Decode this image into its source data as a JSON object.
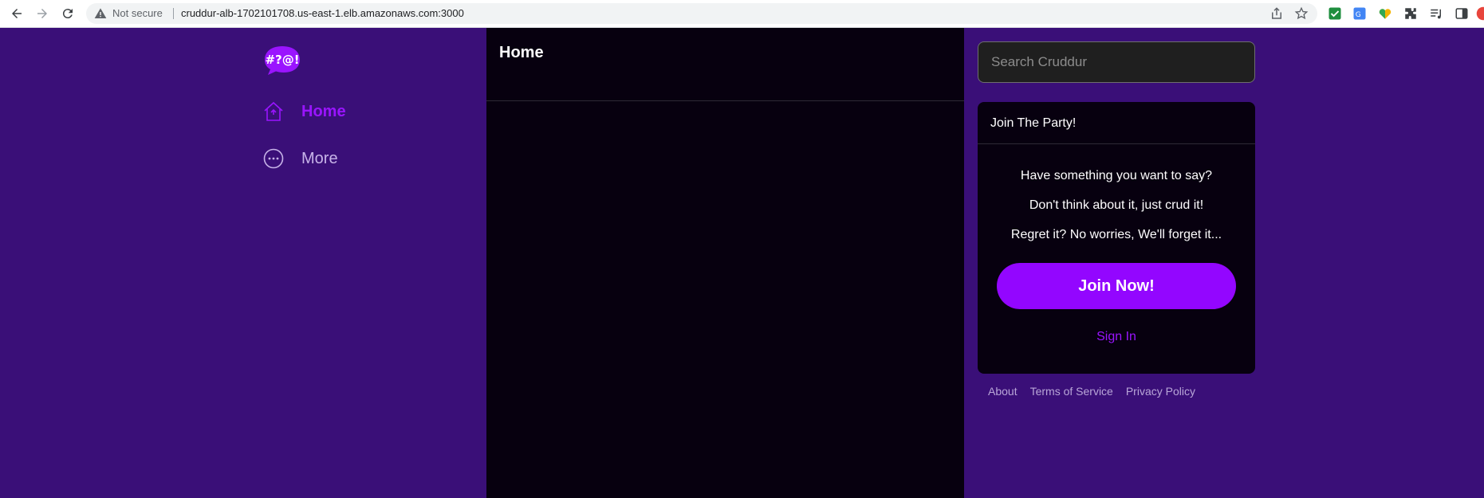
{
  "browser": {
    "security_label": "Not secure",
    "url": "cruddur-alb-1702101708.us-east-1.elb.amazonaws.com:3000"
  },
  "sidebar": {
    "logo_text": "#?@!",
    "items": [
      {
        "label": "Home",
        "icon": "home-icon",
        "active": true
      },
      {
        "label": "More",
        "icon": "more-icon",
        "active": false
      }
    ]
  },
  "main": {
    "title": "Home"
  },
  "search": {
    "placeholder": "Search Cruddur"
  },
  "join": {
    "title": "Join The Party!",
    "lines": [
      "Have something you want to say?",
      "Don't think about it, just crud it!",
      "Regret it? No worries, We'll forget it..."
    ],
    "join_label": "Join Now!",
    "signin_label": "Sign In"
  },
  "footer": {
    "links": [
      "About",
      "Terms of Service",
      "Privacy Policy"
    ]
  },
  "colors": {
    "background": "#3a0f78",
    "panel": "#07000f",
    "accent": "#9306ff"
  }
}
